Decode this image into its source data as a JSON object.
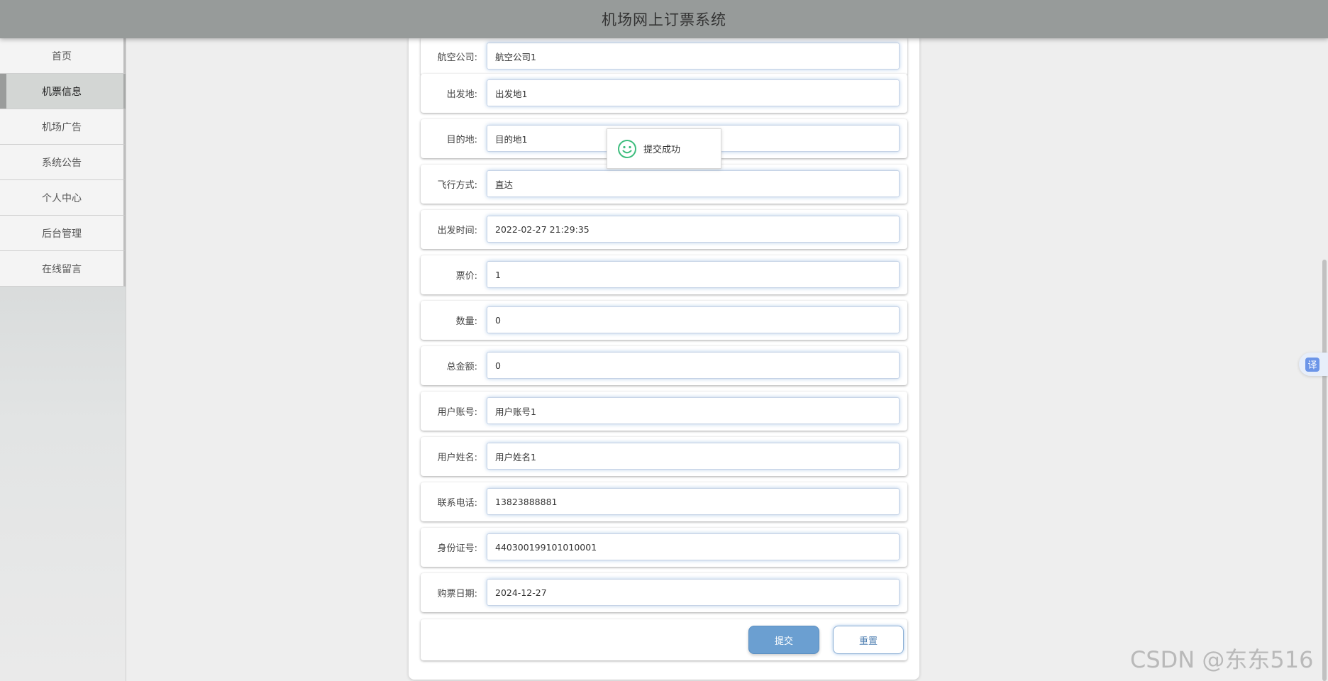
{
  "header": {
    "title": "机场网上订票系统"
  },
  "sidebar": {
    "items": [
      {
        "label": "首页"
      },
      {
        "label": "机票信息"
      },
      {
        "label": "机场广告"
      },
      {
        "label": "系统公告"
      },
      {
        "label": "个人中心"
      },
      {
        "label": "后台管理"
      },
      {
        "label": "在线留言"
      }
    ],
    "active_index": 1
  },
  "form": {
    "fields": [
      {
        "label": "航空公司:",
        "value": "航空公司1"
      },
      {
        "label": "出发地:",
        "value": "出发地1"
      },
      {
        "label": "目的地:",
        "value": "目的地1"
      },
      {
        "label": "飞行方式:",
        "value": "直达"
      },
      {
        "label": "出发时间:",
        "value": "2022-02-27 21:29:35"
      },
      {
        "label": "票价:",
        "value": "1"
      },
      {
        "label": "数量:",
        "value": "0"
      },
      {
        "label": "总金额:",
        "value": "0"
      },
      {
        "label": "用户账号:",
        "value": "用户账号1"
      },
      {
        "label": "用户姓名:",
        "value": "用户姓名1"
      },
      {
        "label": "联系电话:",
        "value": "13823888881"
      },
      {
        "label": "身份证号:",
        "value": "440300199101010001"
      },
      {
        "label": "购票日期:",
        "value": "2024-12-27"
      }
    ],
    "submit_label": "提交",
    "reset_label": "重置"
  },
  "toast": {
    "text": "提交成功",
    "icon": "smile-icon"
  },
  "translate": {
    "label": "译"
  },
  "watermark": "CSDN @东东516",
  "colors": {
    "header_bg": "#979b9a",
    "submit_bg": "#6b9fd1",
    "toast_icon": "#3dbd7d"
  }
}
